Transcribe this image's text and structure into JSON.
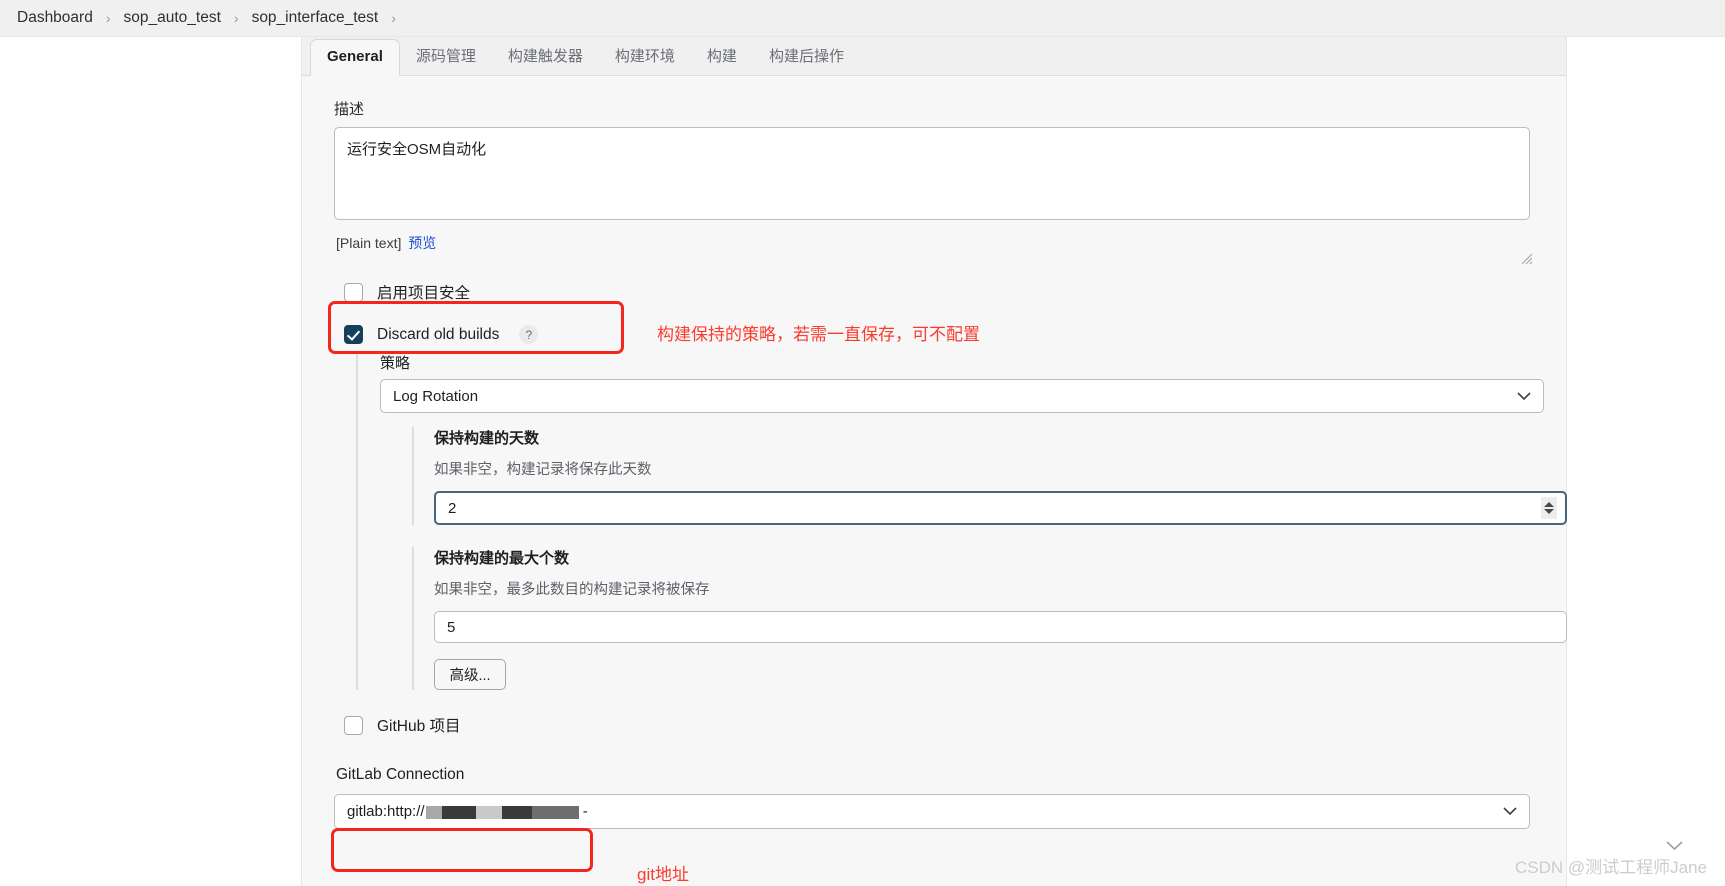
{
  "breadcrumb": {
    "items": [
      "Dashboard",
      "sop_auto_test",
      "sop_interface_test"
    ],
    "separator": "›"
  },
  "tabs": [
    {
      "label": "General",
      "active": true
    },
    {
      "label": "源码管理",
      "active": false
    },
    {
      "label": "构建触发器",
      "active": false
    },
    {
      "label": "构建环境",
      "active": false
    },
    {
      "label": "构建",
      "active": false
    },
    {
      "label": "构建后操作",
      "active": false
    }
  ],
  "description": {
    "label": "描述",
    "value": "运行安全OSM自动化",
    "format_note": "[Plain text]",
    "preview_link": "预览"
  },
  "checkboxes": {
    "project_security": {
      "label": "启用项目安全",
      "checked": false
    },
    "discard_old_builds": {
      "label": "Discard old builds",
      "checked": true,
      "help": "?"
    },
    "github_project": {
      "label": "GitHub 项目",
      "checked": false
    }
  },
  "strategy": {
    "label": "策略",
    "selected": "Log Rotation",
    "chevron": "⌄",
    "days_to_keep": {
      "label": "保持构建的天数",
      "hint": "如果非空，构建记录将保存此天数",
      "value": "2"
    },
    "max_builds_to_keep": {
      "label": "保持构建的最大个数",
      "hint": "如果非空，最多此数目的构建记录将被保存",
      "value": "5"
    },
    "advanced_button": "高级..."
  },
  "gitlab": {
    "label": "GitLab Connection",
    "value_prefix": "gitlab:http://",
    "value_suffix": "-",
    "chevron": "⌄"
  },
  "annotations": {
    "discard_note": "构建保持的策略，若需一直保存，可不配置",
    "git_note": "git地址"
  },
  "watermark": "CSDN @测试工程师Jane",
  "colors": {
    "annotation_red": "#fb3b2c",
    "box_red": "#f2261a",
    "checkbox_checked": "#15405c",
    "link_blue": "#1d4ed8",
    "focus_border": "#46647a"
  }
}
